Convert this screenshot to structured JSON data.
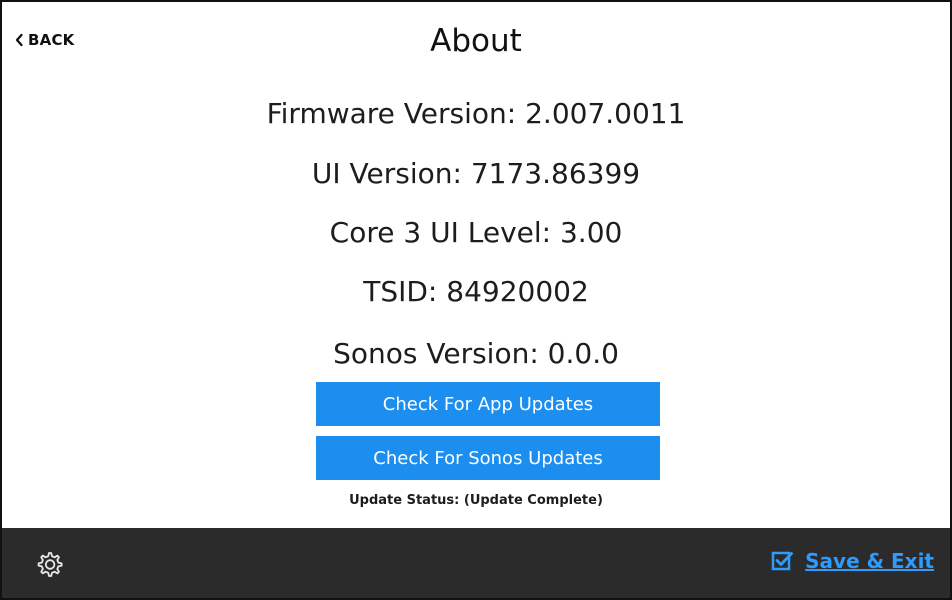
{
  "header": {
    "back_label": "BACK",
    "title": "About"
  },
  "info": {
    "firmware_version": "Firmware Version: 2.007.0011",
    "ui_version": "UI Version: 7173.86399",
    "core_ui_level": "Core 3 UI Level: 3.00",
    "tsid": "TSID: 84920002",
    "sonos_version": "Sonos Version: 0.0.0"
  },
  "buttons": {
    "check_app_updates": "Check For App Updates",
    "check_sonos_updates": "Check For Sonos Updates"
  },
  "status": {
    "update_status": "Update Status: (Update Complete)"
  },
  "footer": {
    "save_exit_label": "Save & Exit"
  },
  "icons": {
    "back": "chevron-left-icon",
    "settings": "gear-icon",
    "save": "checkbox-icon"
  },
  "colors": {
    "accent": "#1b8ef0",
    "footer_bg": "#2b2b2b",
    "save_text": "#2d9bff"
  }
}
